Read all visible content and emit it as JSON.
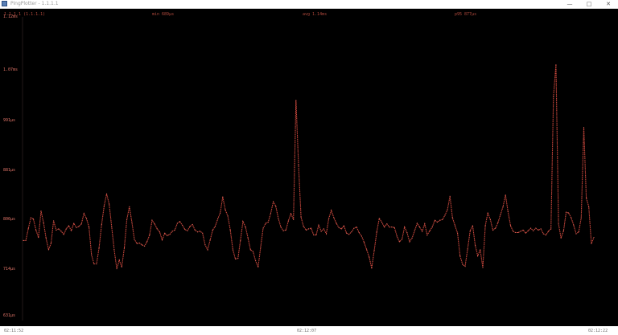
{
  "window": {
    "title": "PingPlotter - 1.1.1.1",
    "minimize_icon": "minimize-icon",
    "maximize_icon": "maximize-icon",
    "close_icon": "close-icon"
  },
  "header": {
    "target": "1.1.1.1 (1.1.1.1)",
    "min": "min 689µs",
    "avg": "avg 1.14ms",
    "p95": "p95 877µs"
  },
  "colors": {
    "line": "#c8473c",
    "background": "#000000",
    "label": "#b24a3d"
  },
  "chart_data": {
    "type": "line",
    "title": "",
    "xlabel": "",
    "ylabel": "",
    "y_ticks": [
      "1.12ms",
      "1.07ms",
      "991µs",
      "881µs",
      "806µs",
      "714µs",
      "631µs"
    ],
    "x_ticks": [
      "02:11:52",
      "02:12:07",
      "02:12:22"
    ],
    "ylim": [
      631,
      1120
    ],
    "grid": false,
    "series": [
      {
        "values": [
          756,
          756,
          776,
          793,
          791,
          773,
          761,
          804,
          785,
          760,
          741,
          752,
          788,
          773,
          775,
          771,
          766,
          775,
          780,
          772,
          784,
          777,
          779,
          783,
          800,
          792,
          778,
          733,
          718,
          718,
          744,
          782,
          812,
          832,
          815,
          778,
          741,
          710,
          724,
          713,
          744,
          790,
          811,
          786,
          758,
          751,
          752,
          749,
          747,
          754,
          765,
          789,
          783,
          775,
          770,
          757,
          768,
          764,
          766,
          771,
          773,
          784,
          787,
          781,
          774,
          772,
          779,
          782,
          773,
          770,
          771,
          768,
          749,
          741,
          757,
          773,
          779,
          791,
          801,
          827,
          806,
          796,
          773,
          741,
          726,
          727,
          756,
          787,
          778,
          760,
          741,
          738,
          723,
          713,
          745,
          776,
          784,
          786,
          800,
          819,
          812,
          792,
          778,
          772,
          773,
          788,
          800,
          790,
          984,
          879,
          794,
          779,
          773,
          775,
          776,
          765,
          765,
          781,
          771,
          775,
          767,
          792,
          805,
          793,
          784,
          777,
          775,
          780,
          768,
          766,
          770,
          776,
          778,
          769,
          763,
          753,
          741,
          729,
          711,
          740,
          770,
          792,
          786,
          778,
          783,
          778,
          778,
          777,
          763,
          754,
          758,
          778,
          769,
          754,
          760,
          772,
          784,
          778,
          771,
          783,
          765,
          772,
          778,
          789,
          786,
          789,
          790,
          797,
          806,
          828,
          793,
          780,
          768,
          731,
          717,
          714,
          742,
          772,
          780,
          748,
          731,
          741,
          712,
          780,
          801,
          790,
          773,
          776,
          785,
          798,
          811,
          830,
          803,
          780,
          771,
          769,
          769,
          771,
          773,
          768,
          772,
          776,
          772,
          776,
          773,
          775,
          767,
          765,
          771,
          775,
          990,
          1042,
          783,
          760,
          772,
          802,
          801,
          793,
          781,
          767,
          770,
          793,
          940,
          825,
          811,
          751,
          761
        ]
      }
    ]
  }
}
